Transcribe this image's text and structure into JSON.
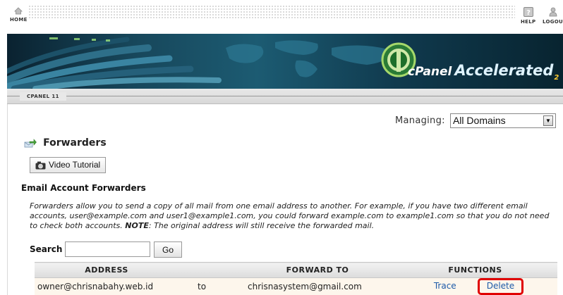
{
  "topbar": {
    "home_label": "HOME",
    "help_label": "HELP",
    "logout_label": "LOGOU"
  },
  "banner": {
    "brand": "cPanel",
    "brand_accent": "Accelerated",
    "brand_sub": "2"
  },
  "breadcrumb": {
    "label": "CPANEL 11"
  },
  "managing": {
    "label": "Managing:",
    "selected": "All Domains"
  },
  "page": {
    "title": "Forwarders",
    "video_label": "Video Tutorial",
    "section_heading": "Email Account Forwarders"
  },
  "description": {
    "part1": "Forwarders allow you to send a copy of all mail from one email address to another. For example, if you have two different email accounts, user@example.com and user1@example1.com, you could forward example.com to example1.com so that you do not need to check both accounts. ",
    "note_label": "NOTE",
    "part2": ": The original address will still receive the forwarded mail."
  },
  "search": {
    "label": "Search",
    "value": "",
    "go_label": "Go"
  },
  "table": {
    "headers": {
      "address": "ADDRESS",
      "forward_to": "FORWARD TO",
      "functions": "FUNCTIONS"
    },
    "rows": [
      {
        "address": "owner@chrisnabahy.web.id",
        "to": "to",
        "forward_to": "chrisnasystem@gmail.com",
        "trace": "Trace",
        "delete": "Delete"
      }
    ]
  },
  "colors": {
    "link": "#1d5aa8",
    "highlight": "#e00000",
    "row_bg": "#fdf6ec"
  }
}
